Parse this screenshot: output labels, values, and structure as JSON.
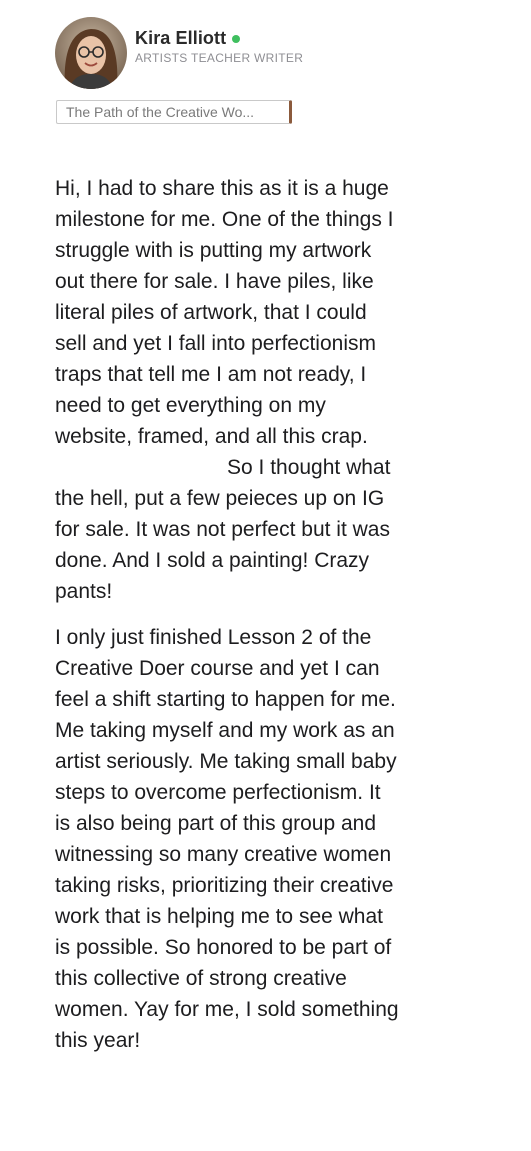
{
  "author": {
    "name": "Kira Elliott",
    "tagline": "ARTISTS TEACHER WRITER",
    "status_color": "#3fbf5f",
    "avatar_icon": "profile-photo"
  },
  "course_tag": {
    "label": "The Path of the Creative Wo..."
  },
  "post": {
    "paragraph1": [
      "Hi, I had to share this as it is a huge",
      "milestone for me. One of the things I",
      "struggle with is putting my artwork",
      "out there for sale. I have piles, like",
      "literal piles of artwork, that I could",
      "sell and yet I fall into perfectionism",
      "traps that tell me I am not ready, I",
      "need to get everything on my",
      "website, framed, and all this crap.",
      "So I thought what",
      "the hell, put a few peieces up on IG",
      "for sale. It was not perfect but it was",
      "done. And I sold a painting! Crazy",
      "pants!"
    ],
    "paragraph2": [
      "I only just finished Lesson 2 of the",
      "Creative Doer course and yet I can",
      "feel a shift starting to happen for me.",
      "Me taking myself and my work as an",
      "artist seriously. Me taking small baby",
      "steps to overcome perfectionism. It",
      "is also being part of this group and",
      "witnessing so many creative women",
      "taking risks, prioritizing their creative",
      "work  that is helping me to see what",
      "is possible. So honored to be part of",
      "this collective of strong creative",
      "women. Yay for me, I sold something",
      "this year!"
    ]
  }
}
